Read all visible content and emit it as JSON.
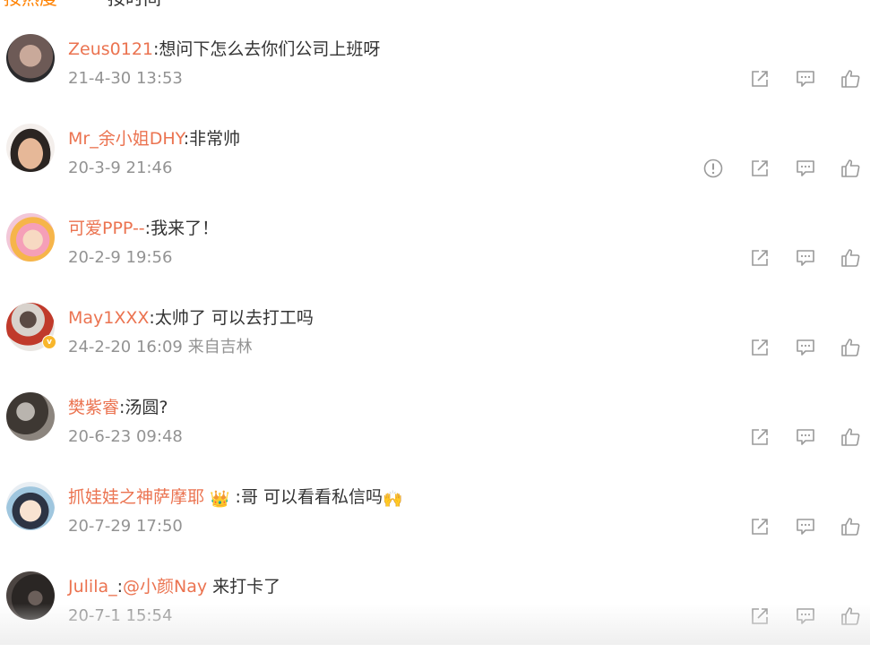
{
  "sort_tabs": {
    "hot": "按热度",
    "time": "按时间"
  },
  "comments": [
    {
      "user": "Zeus0121",
      "separator": ":",
      "text": "想问下怎么去你们公司上班呀",
      "time": "21-4-30 13:53"
    },
    {
      "user": "Mr_余小姐DHY",
      "separator": ":",
      "text": "非常帅",
      "time": "20-3-9 21:46"
    },
    {
      "user": "可爱PPP--",
      "separator": ":",
      "text": "我来了！",
      "time": "20-2-9 19:56"
    },
    {
      "user": "May1XXX",
      "separator": ":",
      "text": "太帅了 可以去打工吗",
      "time": "24-2-20 16:09 来自吉林"
    },
    {
      "user": "樊紫睿",
      "separator": ":",
      "text": "汤圆?",
      "time": "20-6-23 09:48"
    },
    {
      "user": "抓娃娃之神萨摩耶",
      "separator": ":",
      "text": "哥 可以看看私信吗",
      "time": "20-7-29 17:50"
    },
    {
      "user": "Julila_",
      "separator": ":",
      "mention": "@小颜Nay",
      "text": " 来打卡了",
      "time": "20-7-1 15:54"
    }
  ],
  "icons": [
    "report-icon",
    "share-icon",
    "reply-icon",
    "like-icon",
    "verified-badge-icon",
    "crown-emoji-icon",
    "raised-hands-emoji-icon"
  ],
  "colors": {
    "accent": "#ff8200",
    "username": "#eb7350",
    "timestamp": "#939393",
    "icon": "#9a9a9a"
  }
}
